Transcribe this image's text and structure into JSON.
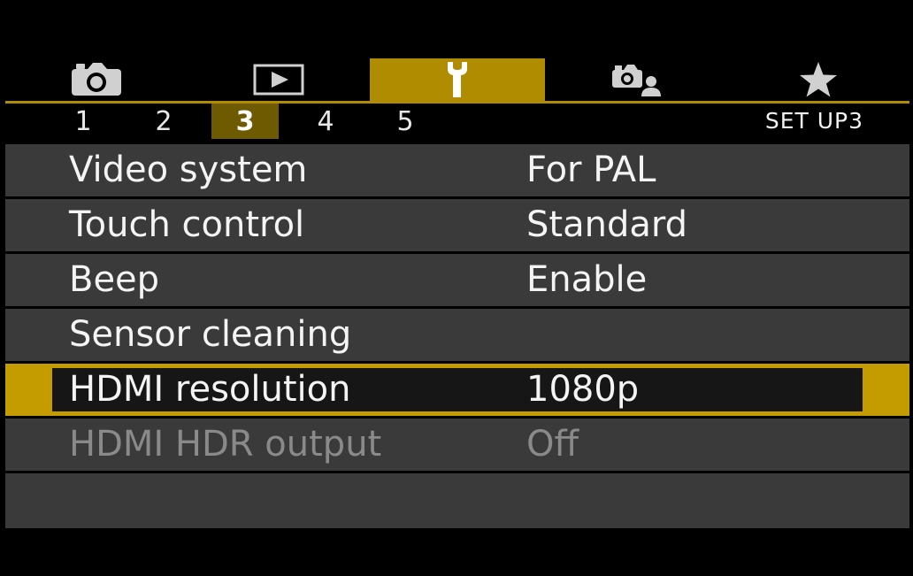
{
  "tabs": [
    {
      "icon": "camera-icon",
      "active": false
    },
    {
      "icon": "playback-icon",
      "active": false
    },
    {
      "icon": "wrench-icon",
      "active": true
    },
    {
      "icon": "custom-functions-icon",
      "active": false
    },
    {
      "icon": "star-icon",
      "active": false
    }
  ],
  "subtabs": [
    "1",
    "2",
    "3",
    "4",
    "5"
  ],
  "active_subtab": "3",
  "section_label": "SET UP3",
  "menu_items": [
    {
      "label": "Video system",
      "value": "For PAL",
      "state": "normal"
    },
    {
      "label": "Touch control",
      "value": "Standard",
      "state": "normal"
    },
    {
      "label": "Beep",
      "value": "Enable",
      "state": "normal"
    },
    {
      "label": "Sensor cleaning",
      "value": "",
      "state": "normal"
    },
    {
      "label": "HDMI resolution",
      "value": "1080p",
      "state": "selected"
    },
    {
      "label": "HDMI HDR output",
      "value": "Off",
      "state": "disabled"
    }
  ],
  "colors": {
    "accent": "#b08d00",
    "selected_frame": "#c59c00",
    "active_subtab": "#6e5a00",
    "row_background": "#3a3a3a",
    "disabled_text": "#8a8a8a"
  }
}
